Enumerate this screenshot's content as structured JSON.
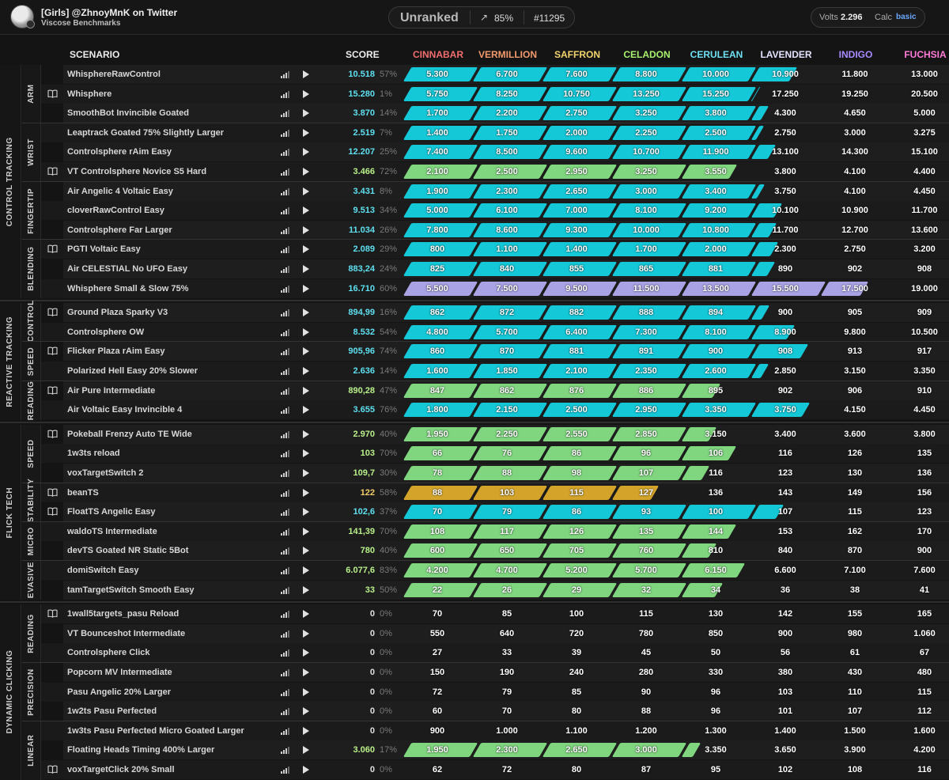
{
  "header": {
    "user_line": "[Girls] @ZhnoyMnK on Twitter",
    "benchmark": "Viscose Benchmarks",
    "rank_name": "Unranked",
    "rank_pct": "85%",
    "rank_pos": "#11295",
    "volts_label": "Volts",
    "volts_value": "2.296",
    "calc_label": "Calc",
    "calc_value": "basic"
  },
  "columns": {
    "scenario": "SCENARIO",
    "score": "SCORE",
    "ranks": [
      {
        "name": "CINNABAR",
        "color": "#f26d6d"
      },
      {
        "name": "VERMILLION",
        "color": "#f29a6d"
      },
      {
        "name": "SAFFRON",
        "color": "#f2d36d"
      },
      {
        "name": "CELADON",
        "color": "#a7f06d"
      },
      {
        "name": "CERULEAN",
        "color": "#6de0f2"
      },
      {
        "name": "LAVENDER",
        "color": "#e3e3ff"
      },
      {
        "name": "INDIGO",
        "color": "#a98bff"
      },
      {
        "name": "FUCHSIA",
        "color": "#ff7bd6"
      }
    ]
  },
  "colors": {
    "cyan": "#14c8d8",
    "green": "#7fd67f",
    "gold": "#d4a42a",
    "lavender": "#a9a3e6",
    "score_cyan": "#5ee0f0",
    "score_green": "#b9f08a",
    "score_gold": "#f2cf6a"
  },
  "categories": [
    {
      "name": "CONTROL TRACKING",
      "subcategories": [
        {
          "name": "ARM",
          "rows": [
            {
              "name": "WhisphereRawControl",
              "book": false,
              "score": "10.518",
              "pct": "57%",
              "tier": "cyan",
              "fill": 5.57,
              "thresholds": [
                "5.300",
                "6.700",
                "7.600",
                "8.800",
                "10.000",
                "10.900",
                "11.800",
                "13.000"
              ]
            },
            {
              "name": "Whisphere",
              "book": true,
              "score": "15.280",
              "pct": "1%",
              "tier": "cyan",
              "fill": 5.01,
              "thresholds": [
                "5.750",
                "8.250",
                "10.750",
                "13.250",
                "15.250",
                "17.250",
                "19.250",
                "20.500"
              ]
            },
            {
              "name": "SmoothBot Invincible Goated",
              "book": false,
              "score": "3.870",
              "pct": "14%",
              "tier": "cyan",
              "fill": 5.14,
              "thresholds": [
                "1.700",
                "2.200",
                "2.750",
                "3.250",
                "3.800",
                "4.300",
                "4.650",
                "5.000"
              ]
            }
          ]
        },
        {
          "name": "WRIST",
          "rows": [
            {
              "name": "Leaptrack Goated 75% Slightly Larger",
              "book": false,
              "score": "2.519",
              "pct": "7%",
              "tier": "cyan",
              "fill": 5.07,
              "thresholds": [
                "1.400",
                "1.750",
                "2.000",
                "2.250",
                "2.500",
                "2.750",
                "3.000",
                "3.275"
              ]
            },
            {
              "name": "Controlsphere rAim Easy",
              "book": false,
              "score": "12.207",
              "pct": "25%",
              "tier": "cyan",
              "fill": 5.25,
              "thresholds": [
                "7.400",
                "8.500",
                "9.600",
                "10.700",
                "11.900",
                "13.100",
                "14.300",
                "15.100"
              ]
            },
            {
              "name": "VT Controlsphere Novice S5 Hard",
              "book": true,
              "score": "3.466",
              "pct": "72%",
              "tier": "green",
              "fill": 4.72,
              "thresholds": [
                "2.100",
                "2.500",
                "2.950",
                "3.250",
                "3.550",
                "3.800",
                "4.100",
                "4.400"
              ]
            }
          ]
        },
        {
          "name": "FINGERTIP",
          "rows": [
            {
              "name": "Air Angelic 4 Voltaic Easy",
              "book": false,
              "score": "3.431",
              "pct": "8%",
              "tier": "cyan",
              "fill": 5.08,
              "thresholds": [
                "1.900",
                "2.300",
                "2.650",
                "3.000",
                "3.400",
                "3.750",
                "4.100",
                "4.450"
              ]
            },
            {
              "name": "cloverRawControl Easy",
              "book": false,
              "score": "9.513",
              "pct": "34%",
              "tier": "cyan",
              "fill": 5.34,
              "thresholds": [
                "5.000",
                "6.100",
                "7.000",
                "8.100",
                "9.200",
                "10.100",
                "10.900",
                "11.700"
              ]
            },
            {
              "name": "Controlsphere Far Larger",
              "book": false,
              "score": "11.034",
              "pct": "26%",
              "tier": "cyan",
              "fill": 5.26,
              "thresholds": [
                "7.800",
                "8.600",
                "9.300",
                "10.000",
                "10.800",
                "11.700",
                "12.700",
                "13.600"
              ]
            }
          ]
        },
        {
          "name": "BLENDING",
          "rows": [
            {
              "name": "PGTI Voltaic Easy",
              "book": true,
              "score": "2.089",
              "pct": "29%",
              "tier": "cyan",
              "fill": 5.29,
              "thresholds": [
                "800",
                "1.100",
                "1.400",
                "1.700",
                "2.000",
                "2.300",
                "2.750",
                "3.200"
              ]
            },
            {
              "name": "Air CELESTIAL No UFO Easy",
              "book": false,
              "score": "883,24",
              "pct": "24%",
              "tier": "cyan",
              "fill": 5.24,
              "thresholds": [
                "825",
                "840",
                "855",
                "865",
                "881",
                "890",
                "902",
                "908"
              ]
            },
            {
              "name": "Whisphere Small & Slow 75%",
              "book": false,
              "score": "16.710",
              "pct": "60%",
              "tier": "lavender",
              "fill": 6.6,
              "thresholds": [
                "5.500",
                "7.500",
                "9.500",
                "11.500",
                "13.500",
                "15.500",
                "17.500",
                "19.000"
              ]
            }
          ]
        }
      ]
    },
    {
      "name": "REACTIVE TRACKING",
      "subcategories": [
        {
          "name": "CONTROL",
          "rows": [
            {
              "name": "Ground Plaza Sparky V3",
              "book": true,
              "score": "894,99",
              "pct": "16%",
              "tier": "cyan",
              "fill": 5.16,
              "thresholds": [
                "862",
                "872",
                "882",
                "888",
                "894",
                "900",
                "905",
                "909"
              ]
            },
            {
              "name": "Controlsphere OW",
              "book": false,
              "score": "8.532",
              "pct": "54%",
              "tier": "cyan",
              "fill": 5.54,
              "thresholds": [
                "4.800",
                "5.700",
                "6.400",
                "7.300",
                "8.100",
                "8.900",
                "9.800",
                "10.500"
              ]
            }
          ]
        },
        {
          "name": "SPEED",
          "rows": [
            {
              "name": "Flicker Plaza rAim Easy",
              "book": true,
              "score": "905,96",
              "pct": "74%",
              "tier": "cyan",
              "fill": 5.74,
              "thresholds": [
                "860",
                "870",
                "881",
                "891",
                "900",
                "908",
                "913",
                "917"
              ]
            },
            {
              "name": "Polarized Hell Easy 20% Slower",
              "book": false,
              "score": "2.636",
              "pct": "14%",
              "tier": "cyan",
              "fill": 5.14,
              "thresholds": [
                "1.600",
                "1.850",
                "2.100",
                "2.350",
                "2.600",
                "2.850",
                "3.150",
                "3.350"
              ]
            }
          ]
        },
        {
          "name": "READING",
          "rows": [
            {
              "name": "Air Pure Intermediate",
              "book": true,
              "score": "890,28",
              "pct": "47%",
              "tier": "green",
              "fill": 4.47,
              "thresholds": [
                "847",
                "862",
                "876",
                "886",
                "895",
                "902",
                "906",
                "910"
              ]
            },
            {
              "name": "Air Voltaic Easy Invincible 4",
              "book": false,
              "score": "3.655",
              "pct": "76%",
              "tier": "cyan",
              "fill": 5.76,
              "thresholds": [
                "1.800",
                "2.150",
                "2.500",
                "2.950",
                "3.350",
                "3.750",
                "4.150",
                "4.450"
              ]
            }
          ]
        }
      ]
    },
    {
      "name": "FLICK TECH",
      "subcategories": [
        {
          "name": "SPEED",
          "rows": [
            {
              "name": "Pokeball Frenzy Auto TE Wide",
              "book": true,
              "score": "2.970",
              "pct": "40%",
              "tier": "green",
              "fill": 4.4,
              "thresholds": [
                "1.950",
                "2.250",
                "2.550",
                "2.850",
                "3.150",
                "3.400",
                "3.600",
                "3.800"
              ]
            },
            {
              "name": "1w3ts reload",
              "book": false,
              "score": "103",
              "pct": "70%",
              "tier": "green",
              "fill": 4.7,
              "thresholds": [
                "66",
                "76",
                "86",
                "96",
                "106",
                "116",
                "126",
                "135"
              ]
            },
            {
              "name": "voxTargetSwitch 2",
              "book": false,
              "score": "109,7",
              "pct": "30%",
              "tier": "green",
              "fill": 4.3,
              "thresholds": [
                "78",
                "88",
                "98",
                "107",
                "116",
                "123",
                "130",
                "136"
              ]
            }
          ]
        },
        {
          "name": "STABILITY",
          "rows": [
            {
              "name": "beanTS",
              "book": true,
              "score": "122",
              "pct": "58%",
              "tier": "gold",
              "fill": 3.58,
              "thresholds": [
                "88",
                "103",
                "115",
                "127",
                "136",
                "143",
                "149",
                "156"
              ]
            },
            {
              "name": "FloatTS Angelic Easy",
              "book": true,
              "score": "102,6",
              "pct": "37%",
              "tier": "cyan",
              "fill": 5.37,
              "thresholds": [
                "70",
                "79",
                "86",
                "93",
                "100",
                "107",
                "115",
                "123"
              ]
            }
          ]
        },
        {
          "name": "MICRO",
          "rows": [
            {
              "name": "waldoTS Intermediate",
              "book": false,
              "score": "141,39",
              "pct": "70%",
              "tier": "green",
              "fill": 4.7,
              "thresholds": [
                "108",
                "117",
                "126",
                "135",
                "144",
                "153",
                "162",
                "170"
              ]
            },
            {
              "name": "devTS Goated NR Static 5Bot",
              "book": false,
              "score": "780",
              "pct": "40%",
              "tier": "green",
              "fill": 4.4,
              "thresholds": [
                "600",
                "650",
                "705",
                "760",
                "810",
                "840",
                "870",
                "900"
              ]
            }
          ]
        },
        {
          "name": "EVASIVE",
          "rows": [
            {
              "name": "domiSwitch Easy",
              "book": false,
              "score": "6.077,6",
              "pct": "83%",
              "tier": "green",
              "fill": 4.83,
              "thresholds": [
                "4.200",
                "4.700",
                "5.200",
                "5.700",
                "6.150",
                "6.600",
                "7.100",
                "7.600"
              ]
            },
            {
              "name": "tamTargetSwitch Smooth Easy",
              "book": false,
              "score": "33",
              "pct": "50%",
              "tier": "green",
              "fill": 4.5,
              "thresholds": [
                "22",
                "26",
                "29",
                "32",
                "34",
                "36",
                "38",
                "41"
              ]
            }
          ]
        }
      ]
    },
    {
      "name": "DYNAMIC CLICKING",
      "subcategories": [
        {
          "name": "READING",
          "rows": [
            {
              "name": "1wall5targets_pasu Reload",
              "book": true,
              "score": "0",
              "pct": "0%",
              "tier": "none",
              "fill": 0,
              "thresholds": [
                "70",
                "85",
                "100",
                "115",
                "130",
                "142",
                "155",
                "165"
              ]
            },
            {
              "name": "VT Bounceshot Intermediate",
              "book": false,
              "score": "0",
              "pct": "0%",
              "tier": "none",
              "fill": 0,
              "thresholds": [
                "550",
                "640",
                "720",
                "780",
                "850",
                "900",
                "980",
                "1.060"
              ]
            },
            {
              "name": "Controlsphere Click",
              "book": false,
              "score": "0",
              "pct": "0%",
              "tier": "none",
              "fill": 0,
              "thresholds": [
                "27",
                "33",
                "39",
                "45",
                "50",
                "56",
                "61",
                "67"
              ]
            }
          ]
        },
        {
          "name": "PRECISION",
          "rows": [
            {
              "name": "Popcorn MV Intermediate",
              "book": false,
              "score": "0",
              "pct": "0%",
              "tier": "none",
              "fill": 0,
              "thresholds": [
                "150",
                "190",
                "240",
                "280",
                "330",
                "380",
                "430",
                "480"
              ]
            },
            {
              "name": "Pasu Angelic 20% Larger",
              "book": false,
              "score": "0",
              "pct": "0%",
              "tier": "none",
              "fill": 0,
              "thresholds": [
                "72",
                "79",
                "85",
                "90",
                "96",
                "103",
                "110",
                "115"
              ]
            },
            {
              "name": "1w2ts Pasu Perfected",
              "book": false,
              "score": "0",
              "pct": "0%",
              "tier": "none",
              "fill": 0,
              "thresholds": [
                "60",
                "70",
                "80",
                "88",
                "96",
                "101",
                "107",
                "112"
              ]
            }
          ]
        },
        {
          "name": "LINEAR",
          "rows": [
            {
              "name": "1w3ts Pasu Perfected Micro Goated Larger",
              "book": false,
              "score": "0",
              "pct": "0%",
              "tier": "none",
              "fill": 0,
              "thresholds": [
                "900",
                "1.000",
                "1.100",
                "1.200",
                "1.300",
                "1.400",
                "1.500",
                "1.600"
              ]
            },
            {
              "name": "Floating Heads Timing 400% Larger",
              "book": false,
              "score": "3.060",
              "pct": "17%",
              "tier": "green",
              "fill": 4.17,
              "thresholds": [
                "1.950",
                "2.300",
                "2.650",
                "3.000",
                "3.350",
                "3.650",
                "3.900",
                "4.200"
              ]
            },
            {
              "name": "voxTargetClick 20% Small",
              "book": true,
              "score": "0",
              "pct": "0%",
              "tier": "none",
              "fill": 0,
              "thresholds": [
                "62",
                "72",
                "80",
                "87",
                "95",
                "102",
                "108",
                "116"
              ]
            }
          ]
        }
      ]
    }
  ]
}
